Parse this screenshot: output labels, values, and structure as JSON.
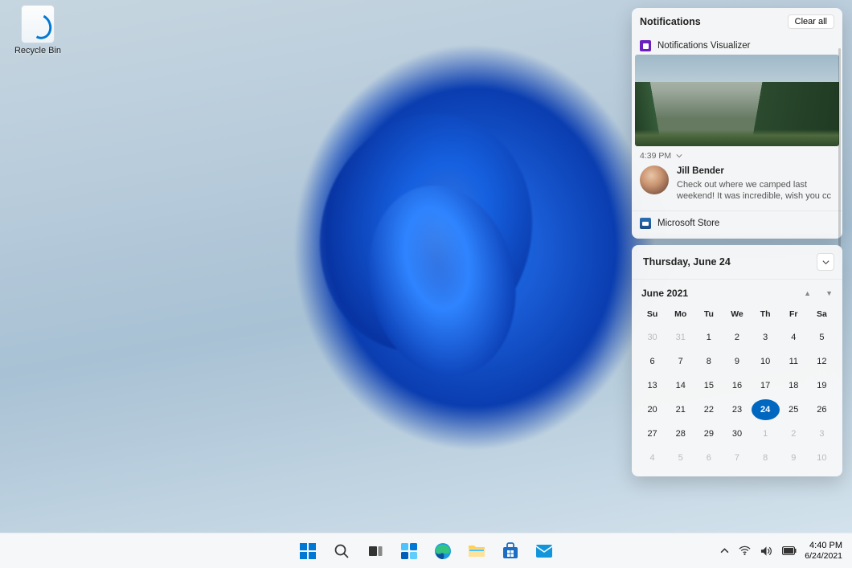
{
  "desktop": {
    "recycle_bin_label": "Recycle Bin"
  },
  "notifications": {
    "header": "Notifications",
    "clear_all": "Clear all",
    "items": [
      {
        "app_icon": "notifications-visualizer-icon",
        "app_name": "Notifications Visualizer",
        "time": "4:39 PM",
        "sender": "Jill Bender",
        "message": "Check out where we camped last weekend! It was incredible, wish you cc"
      },
      {
        "app_icon": "microsoft-store-icon",
        "app_name": "Microsoft Store"
      }
    ]
  },
  "calendar": {
    "today_label": "Thursday, June 24",
    "month_label": "June 2021",
    "dow": [
      "Su",
      "Mo",
      "Tu",
      "We",
      "Th",
      "Fr",
      "Sa"
    ],
    "weeks": [
      [
        {
          "n": 30,
          "o": true
        },
        {
          "n": 31,
          "o": true
        },
        {
          "n": 1
        },
        {
          "n": 2
        },
        {
          "n": 3
        },
        {
          "n": 4
        },
        {
          "n": 5
        }
      ],
      [
        {
          "n": 6
        },
        {
          "n": 7
        },
        {
          "n": 8
        },
        {
          "n": 9
        },
        {
          "n": 10
        },
        {
          "n": 11
        },
        {
          "n": 12
        }
      ],
      [
        {
          "n": 13
        },
        {
          "n": 14
        },
        {
          "n": 15
        },
        {
          "n": 16
        },
        {
          "n": 17
        },
        {
          "n": 18
        },
        {
          "n": 19
        }
      ],
      [
        {
          "n": 20
        },
        {
          "n": 21
        },
        {
          "n": 22
        },
        {
          "n": 23
        },
        {
          "n": 24,
          "today": true
        },
        {
          "n": 25
        },
        {
          "n": 26
        }
      ],
      [
        {
          "n": 27
        },
        {
          "n": 28
        },
        {
          "n": 29
        },
        {
          "n": 30
        },
        {
          "n": 1,
          "o": true
        },
        {
          "n": 2,
          "o": true
        },
        {
          "n": 3,
          "o": true
        }
      ],
      [
        {
          "n": 4,
          "o": true
        },
        {
          "n": 5,
          "o": true
        },
        {
          "n": 6,
          "o": true
        },
        {
          "n": 7,
          "o": true
        },
        {
          "n": 8,
          "o": true
        },
        {
          "n": 9,
          "o": true
        },
        {
          "n": 10,
          "o": true
        }
      ]
    ]
  },
  "taskbar": {
    "apps": [
      {
        "name": "start-button",
        "icon": "windows-logo-icon"
      },
      {
        "name": "search-button",
        "icon": "search-icon"
      },
      {
        "name": "task-view-button",
        "icon": "task-view-icon"
      },
      {
        "name": "widgets-button",
        "icon": "widgets-icon"
      },
      {
        "name": "edge-button",
        "icon": "edge-icon"
      },
      {
        "name": "file-explorer-button",
        "icon": "file-explorer-icon"
      },
      {
        "name": "microsoft-store-button",
        "icon": "microsoft-store-icon"
      },
      {
        "name": "mail-button",
        "icon": "mail-icon"
      }
    ],
    "time": "4:40 PM",
    "date": "6/24/2021"
  }
}
